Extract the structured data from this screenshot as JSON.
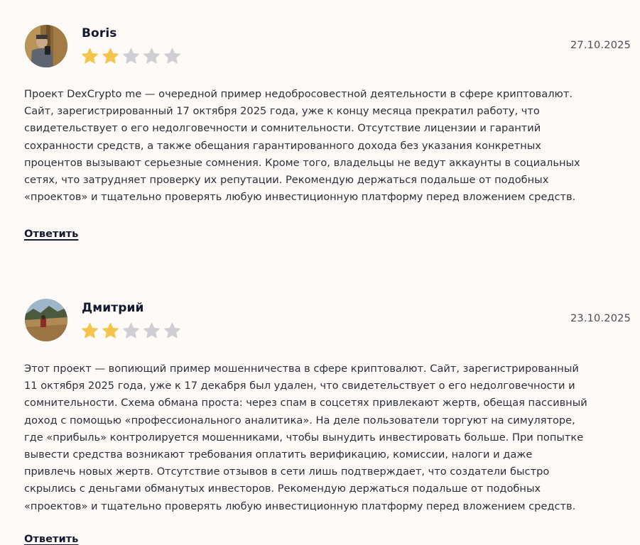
{
  "colors": {
    "background": "#fdfaf7",
    "star_filled": "#f5c44a",
    "star_empty": "#cfcfd3",
    "author": "#141a2e",
    "text": "#2b2f38"
  },
  "reviews": [
    {
      "author": "Boris",
      "rating": 2,
      "max_rating": 5,
      "date": "27.10.2025",
      "text_lines": [
        "Проект DexCrypto me — очередной пример недобросовестной деятельности в сфере криптовалют.",
        "Сайт, зарегистрированный 17 октября 2025 года, уже к концу месяца прекратил работу, что",
        "свидетельствует о его недолговечности и сомнительности. Отсутствие лицензии и гарантий",
        "сохранности средств, а также обещания гарантированного дохода без указания конкретных",
        "процентов вызывают серьезные сомнения. Кроме того, владельцы не ведут аккаунты в социальных",
        "сетях, что затрудняет проверку их репутации. Рекомендую держаться подальше от подобных",
        "«проектов» и тщательно проверять любую инвестиционную платформу перед вложением средств."
      ],
      "reply_label": "Ответить"
    },
    {
      "author": "Дмитрий",
      "rating": 2,
      "max_rating": 5,
      "date": "23.10.2025",
      "text_lines": [
        "Этот проект — вопиющий пример мошенничества в сфере криптовалют. Сайт, зарегистрированный",
        "11 октября 2025 года, уже к 17 декабря был удален, что свидетельствует о его недолговечности и",
        "сомнительности. Схема обмана проста: через спам в соцсетях привлекают жертв, обещая пассивный",
        "доход с помощью «профессионального аналитика». На деле пользователи торгуют на симуляторе,",
        "где «прибыль» контролируется мошенниками, чтобы вынудить инвестировать больше. При попытке",
        "вывести средства возникают требования оплатить верификацию, комиссии, налоги и даже",
        "привлечь новых жертв. Отсутствие отзывов в сети лишь подтверждает, что создатели быстро",
        "скрылись с деньгами обманутых инвесторов. Рекомендую держаться подальше от подобных",
        "«проектов» и тщательно проверять любую инвестиционную платформу перед вложением средств."
      ],
      "reply_label": "Ответить"
    }
  ]
}
